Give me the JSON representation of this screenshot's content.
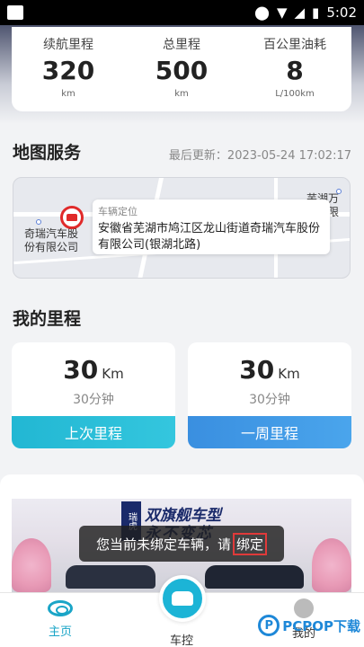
{
  "status_bar": {
    "time": "5:02"
  },
  "stats": [
    {
      "label": "续航里程",
      "value": "320",
      "unit": "km"
    },
    {
      "label": "总里程",
      "value": "500",
      "unit": "km"
    },
    {
      "label": "百公里油耗",
      "value": "8",
      "unit": "L/100km"
    }
  ],
  "map_section": {
    "title": "地图服务",
    "last_update": "最后更新：2023-05-24 17:02:17",
    "map_labels": {
      "left": "奇瑞汽车股份有限公司",
      "right": "芜湖万里有限"
    },
    "tooltip": {
      "title": "车辆定位",
      "address": "安徽省芜湖市鸠江区龙山街道奇瑞汽车股份有限公司(银湖北路)"
    }
  },
  "mileage_section": {
    "title": "我的里程",
    "cards": [
      {
        "value": "30",
        "unit": "Km",
        "duration": "30分钟",
        "button": "上次里程"
      },
      {
        "value": "30",
        "unit": "Km",
        "duration": "30分钟",
        "button": "一周里程"
      }
    ]
  },
  "banner": {
    "logo": "瑞虎",
    "title": "双旗舰车型",
    "subtitle": "永不变芯"
  },
  "toast": {
    "text": "您当前未绑定车辆，请",
    "link": "绑定"
  },
  "tabbar": {
    "home": "主页",
    "control": "车控",
    "mine": "我的"
  },
  "watermark": {
    "logo": "P",
    "text": "PCPOP下载"
  },
  "colors": {
    "accent": "#1cb4d6",
    "pin": "#e02a2a",
    "blue_button": "#3a8fe0"
  }
}
